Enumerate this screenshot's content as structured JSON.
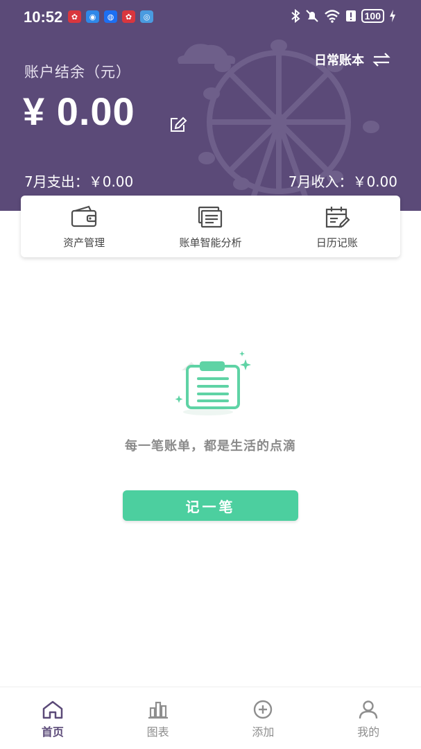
{
  "status_bar": {
    "time": "10:52",
    "battery": "100"
  },
  "header": {
    "book_name": "日常账本",
    "balance_label": "账户结余（元）",
    "balance_value": "¥ 0.00",
    "month_expense": "7月支出：￥0.00",
    "month_income": "7月收入：￥0.00"
  },
  "quick_actions": [
    {
      "label": "资产管理",
      "icon": "wallet-icon"
    },
    {
      "label": "账单智能分析",
      "icon": "bill-analysis-icon"
    },
    {
      "label": "日历记账",
      "icon": "calendar-edit-icon"
    }
  ],
  "empty_state": {
    "text": "每一笔账单，都是生活的点滴",
    "button_label": "记一笔"
  },
  "bottom_nav": [
    {
      "label": "首页",
      "icon": "home-icon",
      "active": true
    },
    {
      "label": "图表",
      "icon": "bar-chart-icon",
      "active": false
    },
    {
      "label": "添加",
      "icon": "add-circle-icon",
      "active": false
    },
    {
      "label": "我的",
      "icon": "profile-icon",
      "active": false
    }
  ],
  "colors": {
    "header_bg": "#5b4a78",
    "accent_green": "#4ccf9f",
    "active_nav": "#5b4a78"
  }
}
